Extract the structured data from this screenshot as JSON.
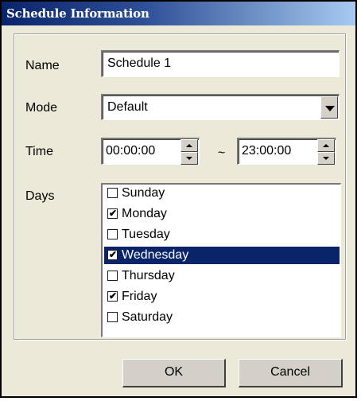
{
  "window": {
    "title": "Schedule Information"
  },
  "form": {
    "name_label": "Name",
    "name_value": "Schedule 1",
    "mode_label": "Mode",
    "mode_value": "Default",
    "time_label": "Time",
    "time_start": "00:00:00",
    "time_separator": "~",
    "time_end": "23:00:00",
    "days_label": "Days"
  },
  "days": [
    {
      "label": "Sunday",
      "checked": false,
      "selected": false
    },
    {
      "label": "Monday",
      "checked": true,
      "selected": false
    },
    {
      "label": "Tuesday",
      "checked": false,
      "selected": false
    },
    {
      "label": "Wednesday",
      "checked": true,
      "selected": true
    },
    {
      "label": "Thursday",
      "checked": false,
      "selected": false
    },
    {
      "label": "Friday",
      "checked": true,
      "selected": false
    },
    {
      "label": "Saturday",
      "checked": false,
      "selected": false
    }
  ],
  "buttons": {
    "ok": "OK",
    "cancel": "Cancel"
  },
  "colors": {
    "title_start": "#0a246a",
    "title_end": "#a6caf0",
    "selection": "#0a246a",
    "face": "#ece9d8"
  }
}
